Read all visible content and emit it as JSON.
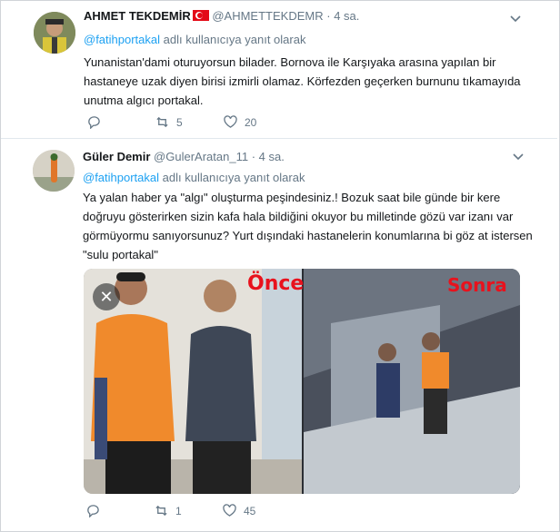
{
  "tweets": [
    {
      "author_name": "AHMET TEKDEMİR",
      "handle": "@AHMETTEKDEMR",
      "time": "4 sa.",
      "reply_prefix": "@fatihportakal",
      "reply_suffix": "adlı kullanıcıya yanıt olarak",
      "text": "Yunanistan'dami oturuyorsun bilader. Bornova ile Karşıyaka arasına yapılan bir hastaneye uzak diyen birisi izmirli olamaz. Körfezden geçerken burnunu tıkamayıda unutma algıcı portakal.",
      "reply_count": "",
      "retweet_count": "5",
      "like_count": "20"
    },
    {
      "author_name": "Güler Demir",
      "handle": "@GulerAratan_11",
      "time": "4 sa.",
      "reply_prefix": "@fatihportakal",
      "reply_suffix": "adlı kullanıcıya yanıt olarak",
      "text": "Ya yalan haber ya \"algı\" oluşturma peşindesiniz.! Bozuk saat bile günde bir kere doğruyu gösterirken sizin kafa hala bildiğini okuyor bu milletinde gözü var izanı var görmüyormu sanıyorsunuz? Yurt dışındaki hastanelerin konumlarına bi göz at istersen \"sulu portakal\"",
      "media": {
        "label_before": "Önce",
        "label_after": "Sonra",
        "close_glyph": "✕"
      },
      "reply_count": "",
      "retweet_count": "1",
      "like_count": "45"
    }
  ],
  "icons": {
    "reply": "reply-icon",
    "retweet": "retweet-icon",
    "like": "heart-icon",
    "menu": "chevron-down-icon",
    "flag": "turkey-flag-icon"
  },
  "colors": {
    "link": "#1da1f2",
    "meta": "#657786",
    "label_red": "#e8121d"
  }
}
